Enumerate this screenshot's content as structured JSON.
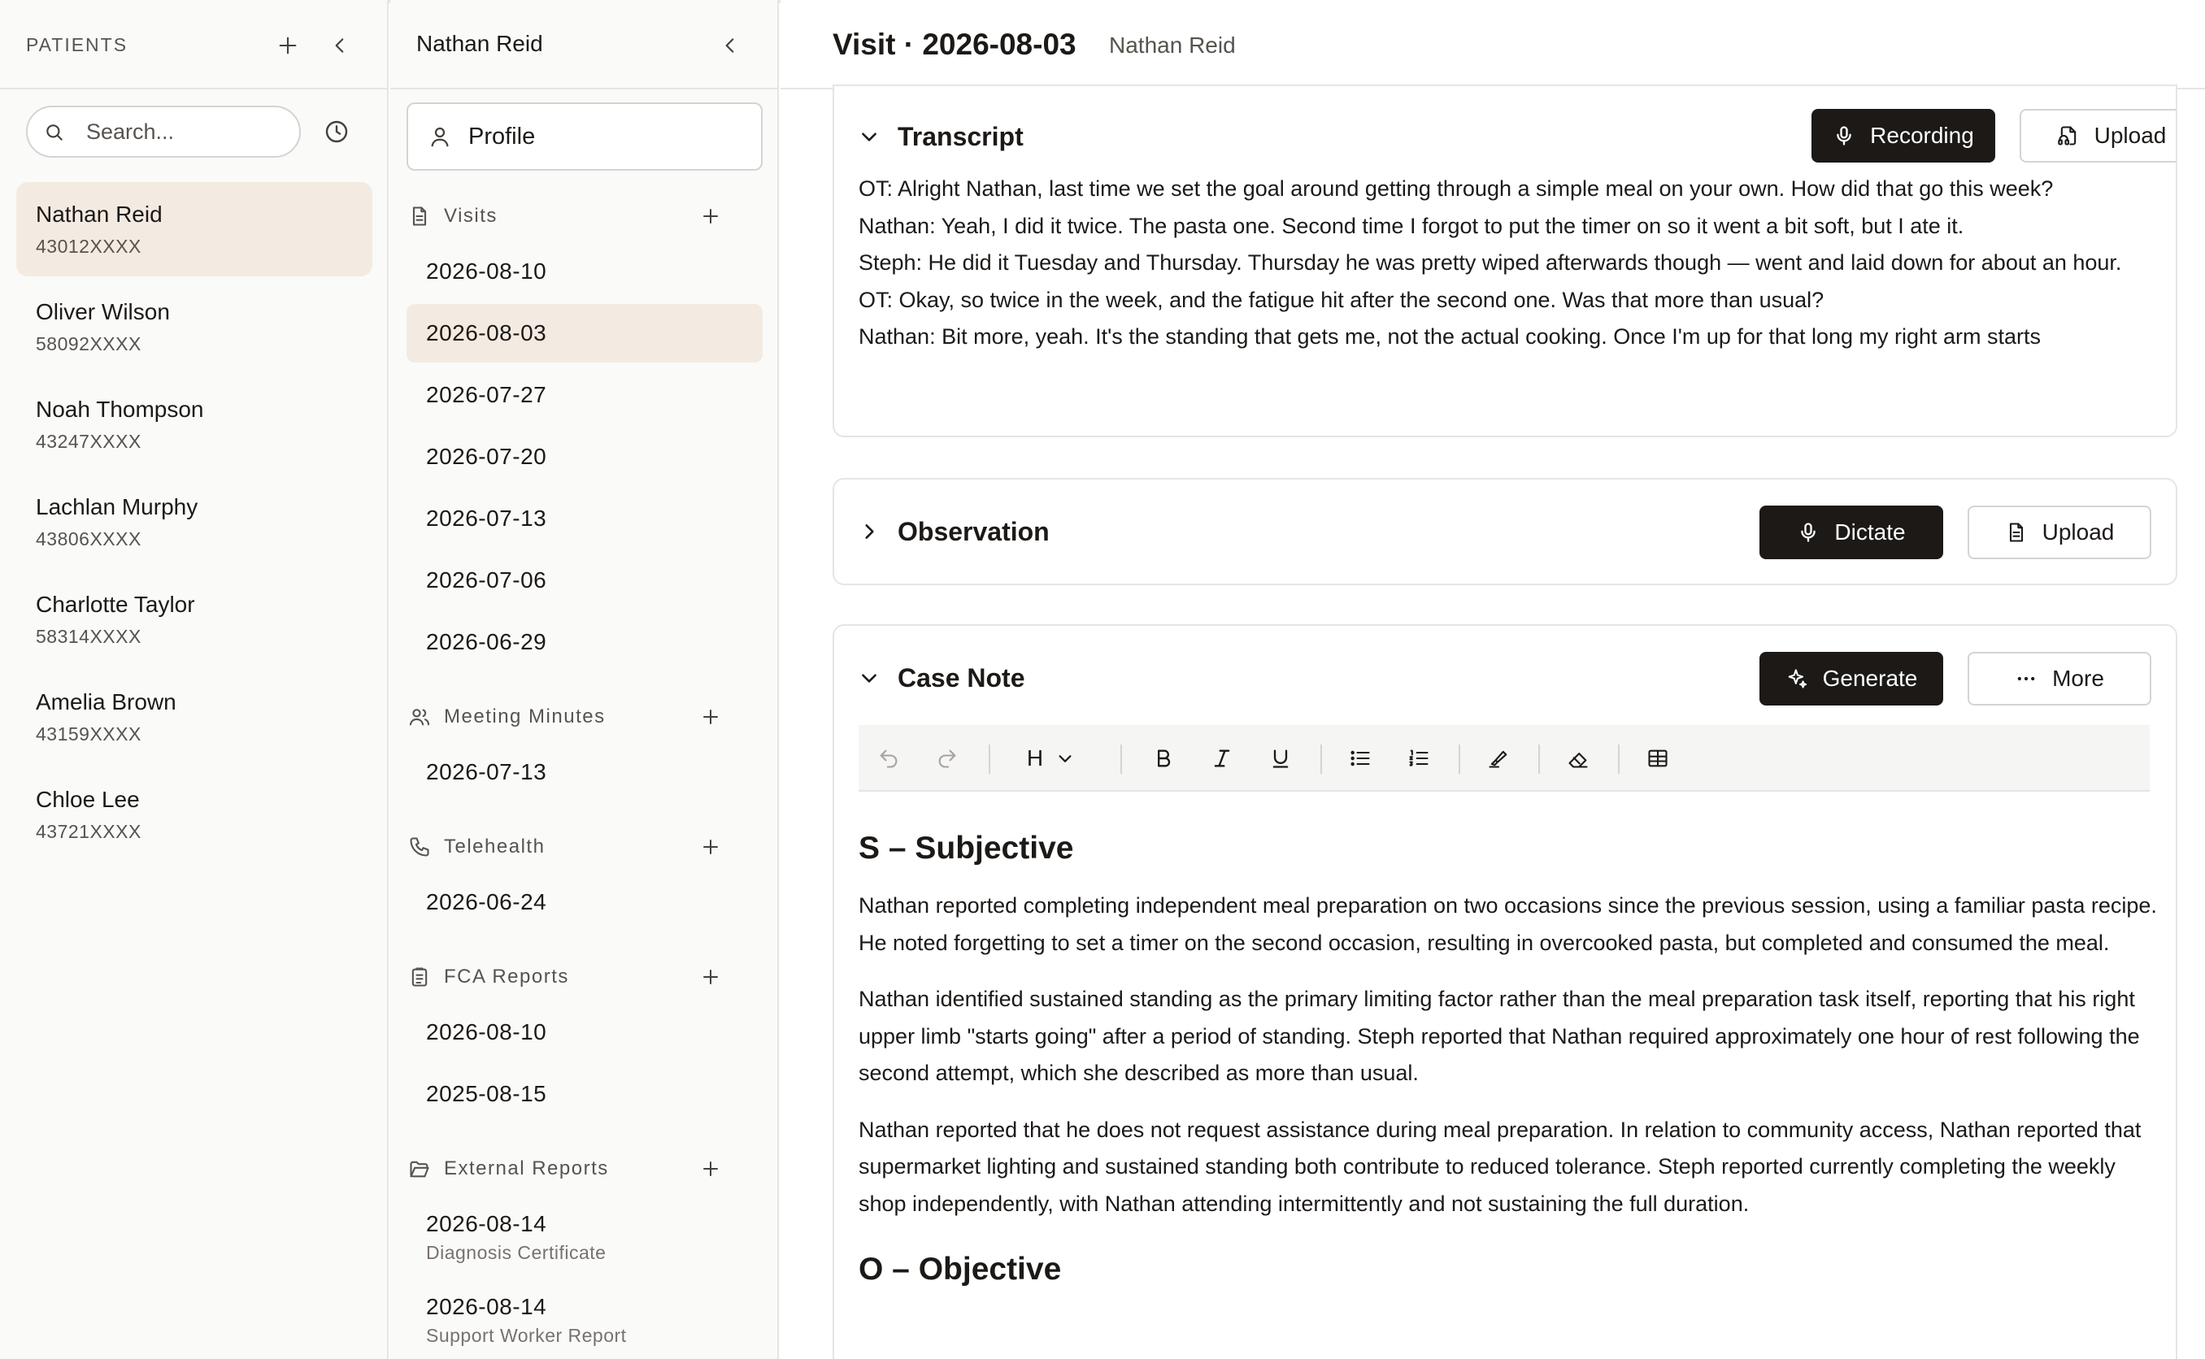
{
  "patients_panel": {
    "title": "PATIENTS",
    "search_placeholder": "Search...",
    "patients": [
      {
        "name": "Nathan Reid",
        "id": "43012XXXX",
        "active": true
      },
      {
        "name": "Oliver Wilson",
        "id": "58092XXXX"
      },
      {
        "name": "Noah Thompson",
        "id": "43247XXXX"
      },
      {
        "name": "Lachlan Murphy",
        "id": "43806XXXX"
      },
      {
        "name": "Charlotte Taylor",
        "id": "58314XXXX"
      },
      {
        "name": "Amelia Brown",
        "id": "43159XXXX"
      },
      {
        "name": "Chloe Lee",
        "id": "43721XXXX"
      }
    ]
  },
  "record_panel": {
    "patient_name": "Nathan Reid",
    "profile_label": "Profile",
    "sections": {
      "visits": {
        "label": "Visits",
        "items": [
          "2026-08-10",
          "2026-08-03",
          "2026-07-27",
          "2026-07-20",
          "2026-07-13",
          "2026-07-06",
          "2026-06-29"
        ]
      },
      "meeting_minutes": {
        "label": "Meeting Minutes",
        "items": [
          "2026-07-13"
        ]
      },
      "telehealth": {
        "label": "Telehealth",
        "items": [
          "2026-06-24"
        ]
      },
      "fca_reports": {
        "label": "FCA Reports",
        "items": [
          "2026-08-10",
          "2025-08-15"
        ]
      },
      "external_reports": {
        "label": "External Reports",
        "items": [
          {
            "date": "2026-08-14",
            "type": "Diagnosis Certificate"
          },
          {
            "date": "2026-08-14",
            "type": "Support Worker Report"
          }
        ]
      }
    }
  },
  "main": {
    "title": "Visit · 2026-08-03",
    "subtitle": "Nathan Reid",
    "transcript": {
      "title": "Transcript",
      "recording_label": "Recording",
      "upload_label": "Upload",
      "lines": [
        "OT: Alright Nathan, last time we set the goal around getting through a simple meal on your own. How did that go this week?",
        "Nathan: Yeah, I did it twice. The pasta one. Second time I forgot to put the timer on so it went a bit soft, but I ate it.",
        "Steph: He did it Tuesday and Thursday. Thursday he was pretty wiped afterwards though — went and laid down for about an hour.",
        "OT: Okay, so twice in the week, and the fatigue hit after the second one. Was that more than usual?",
        "Nathan: Bit more, yeah. It's the standing that gets me, not the actual cooking. Once I'm up for that long my right arm starts"
      ]
    },
    "observation": {
      "title": "Observation",
      "dictate_label": "Dictate",
      "upload_label": "Upload"
    },
    "case_note": {
      "title": "Case Note",
      "generate_label": "Generate",
      "more_label": "More",
      "toolbar": {
        "heading_label": "H"
      },
      "subjective_heading": "S – Subjective",
      "paragraphs": [
        "Nathan reported completing independent meal preparation on two occasions since the previous session, using a familiar pasta recipe. He noted forgetting to set a timer on the second occasion, resulting in overcooked pasta, but completed and consumed the meal.",
        "Nathan identified sustained standing as the primary limiting factor rather than the meal preparation task itself, reporting that his right upper limb \"starts going\" after a period of standing. Steph reported that Nathan required approximately one hour of rest following the second attempt, which she described as more than usual.",
        "Nathan reported that he does not request assistance during meal preparation. In relation to community access, Nathan reported that supermarket lighting and sustained standing both contribute to reduced tolerance. Steph reported currently completing the weekly shop independently, with Nathan attending intermittently and not sustaining the full duration."
      ],
      "objective_heading": "O – Objective"
    }
  },
  "colors": {
    "accent_active_bg": "#f3ebe1",
    "dark_button": "#1c1917",
    "panel_bg": "#fafaf9",
    "border": "#e7e5e4"
  }
}
